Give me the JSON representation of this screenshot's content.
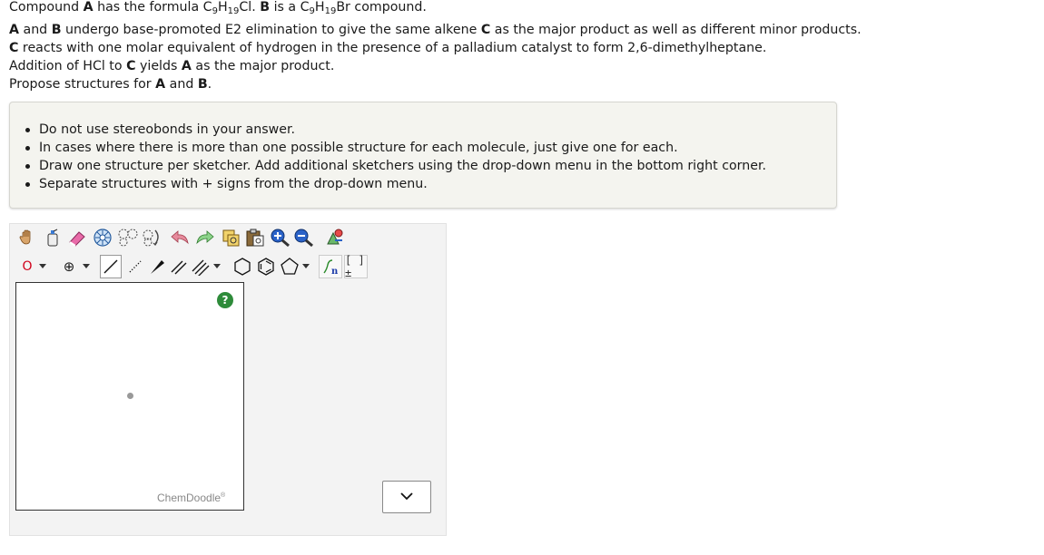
{
  "question": {
    "l1_a": "Compound ",
    "l1_b": "A",
    "l1_c": " has the formula C",
    "l1_d": "9",
    "l1_e": "H",
    "l1_f": "19",
    "l1_g": "Cl. ",
    "l1_h": "B",
    "l1_i": " is a C",
    "l1_j": "9",
    "l1_k": "H",
    "l1_l": "19",
    "l1_m": "Br compound.",
    "l2_a": "A",
    "l2_b": " and ",
    "l2_c": "B",
    "l2_d": " undergo base-promoted E2 elimination to give the same alkene ",
    "l2_e": "C",
    "l2_f": " as the major product as well as different minor products.",
    "l3_a": "C",
    "l3_b": " reacts with one molar equivalent of hydrogen in the presence of a palladium catalyst to form 2,6-dimethylheptane.",
    "l4_a": "Addition of HCl to ",
    "l4_b": "C",
    "l4_c": " yields ",
    "l4_d": "A",
    "l4_e": " as the major product.",
    "l5_a": "Propose structures for ",
    "l5_b": "A",
    "l5_c": " and ",
    "l5_d": "B",
    "l5_e": "."
  },
  "instructions": [
    "Do not use stereobonds in your answer.",
    "In cases where there is more than one possible structure for each molecule, just give one for each.",
    "Draw one structure per sketcher. Add additional sketchers using the drop-down menu in the bottom right corner.",
    "Separate structures with + signs from the drop-down menu."
  ],
  "sketcher": {
    "atom_label": "O",
    "charge_label": "⊕",
    "help_label": "?",
    "brand": "ChemDoodle",
    "brand_mark": "®",
    "bracket_label": "[ ]±",
    "n_label": "n"
  },
  "colors": {
    "help_green": "#2e8b3a",
    "atom_red": "#d0021b",
    "panel_bg": "#f4f4ef"
  }
}
